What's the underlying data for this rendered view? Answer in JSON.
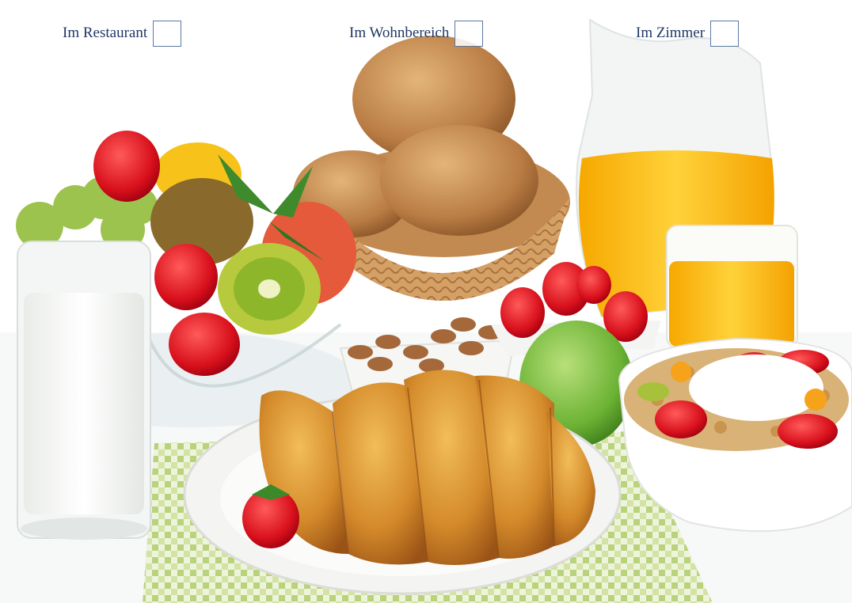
{
  "form": {
    "options": [
      {
        "label": "Im Restaurant",
        "checked": false
      },
      {
        "label": "Im Wohnbereich",
        "checked": false
      },
      {
        "label": "Im Zimmer",
        "checked": false
      }
    ]
  },
  "colors": {
    "label_text": "#1f3864",
    "checkbox_border": "#5b7aa1",
    "background": "#ffffff"
  },
  "image": {
    "items": [
      "milk-glass-icon",
      "fruit-bowl-icon",
      "bread-basket-icon",
      "orange-juice-jug-icon",
      "orange-juice-glass-icon",
      "almond-dish-icon",
      "strawberry-dish-icon",
      "green-apple-icon",
      "muesli-bowl-icon",
      "croissant-plate-icon",
      "checkered-napkin-icon"
    ]
  }
}
